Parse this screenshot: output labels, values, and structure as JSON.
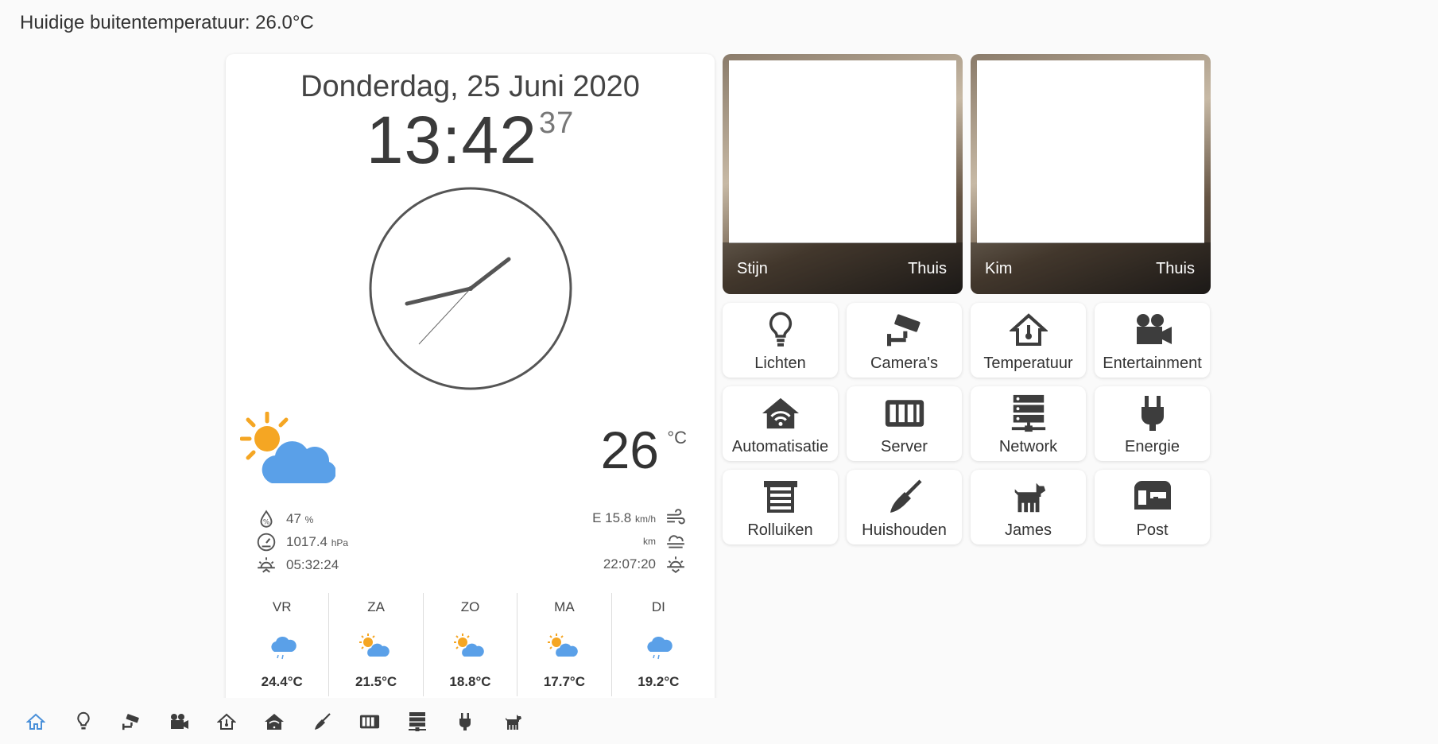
{
  "header": {
    "outside_temp": "Huidige buitentemperatuur: 26.0°C"
  },
  "clock": {
    "date": "Donderdag, 25 Juni 2020",
    "time": "13:42",
    "seconds": "37"
  },
  "weather": {
    "temperature": "26",
    "unit": "°C",
    "humidity": "47",
    "humidity_unit": "%",
    "pressure": "1017.4",
    "pressure_unit": "hPa",
    "sunrise": "05:32:24",
    "wind": "E 15.8",
    "wind_unit": "km/h",
    "visibility_unit": "km",
    "sunset": "22:07:20"
  },
  "forecast": [
    {
      "day": "VR",
      "temp": "24.4°C",
      "icon": "rain-cloud-icon"
    },
    {
      "day": "ZA",
      "temp": "21.5°C",
      "icon": "partly-cloudy-icon"
    },
    {
      "day": "ZO",
      "temp": "18.8°C",
      "icon": "partly-cloudy-icon"
    },
    {
      "day": "MA",
      "temp": "17.7°C",
      "icon": "partly-cloudy-icon"
    },
    {
      "day": "DI",
      "temp": "19.2°C",
      "icon": "rain-cloud-icon"
    }
  ],
  "persons": [
    {
      "name": "Stijn",
      "state": "Thuis"
    },
    {
      "name": "Kim",
      "state": "Thuis"
    }
  ],
  "tiles": [
    {
      "label": "Lichten",
      "icon": "lightbulb-icon"
    },
    {
      "label": "Camera's",
      "icon": "cctv-icon"
    },
    {
      "label": "Temperatuur",
      "icon": "home-thermometer-icon"
    },
    {
      "label": "Entertainment",
      "icon": "movie-camera-icon"
    },
    {
      "label": "Automatisatie",
      "icon": "home-wifi-icon"
    },
    {
      "label": "Server",
      "icon": "server-icon"
    },
    {
      "label": "Network",
      "icon": "server-network-icon"
    },
    {
      "label": "Energie",
      "icon": "power-plug-icon"
    },
    {
      "label": "Rolluiken",
      "icon": "garage-shutter-icon"
    },
    {
      "label": "Huishouden",
      "icon": "broom-icon"
    },
    {
      "label": "James",
      "icon": "dog-icon"
    },
    {
      "label": "Post",
      "icon": "mailbox-icon"
    }
  ],
  "nav_icons": [
    "home-icon",
    "lightbulb-icon",
    "cctv-icon",
    "movie-camera-icon",
    "home-thermometer-icon",
    "home-wifi-icon",
    "broom-icon",
    "server-icon",
    "server-network-icon",
    "power-plug-icon",
    "dog-icon"
  ],
  "colors": {
    "accent": "#4a90d9",
    "sun": "#f5a623",
    "cloud": "#5aa0e8",
    "icon": "#3d3d3d"
  }
}
